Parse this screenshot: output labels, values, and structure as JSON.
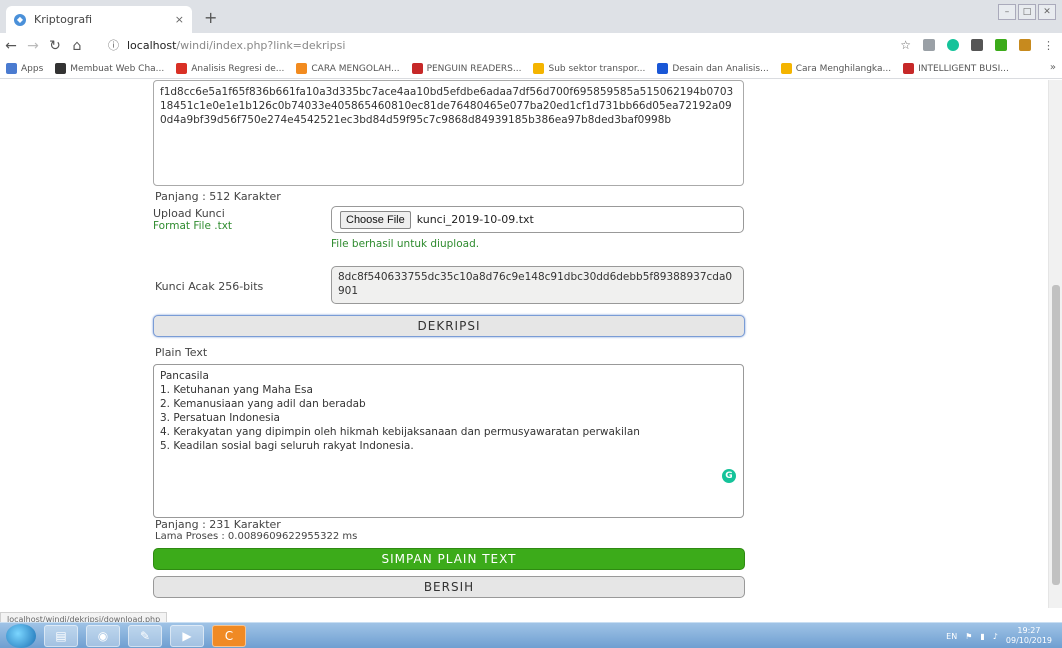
{
  "browser": {
    "tab_title": "Kriptografi",
    "tab_close": "×",
    "new_tab": "+",
    "url_host": "localhost",
    "url_path": "/windi/index.php?link=dekripsi",
    "bookmarks": [
      {
        "label": "Apps",
        "color": "#4a7bd0"
      },
      {
        "label": "Membuat Web Cha...",
        "color": "#333333"
      },
      {
        "label": "Analisis Regresi de...",
        "color": "#d93025"
      },
      {
        "label": "CARA MENGOLAH...",
        "color": "#f28b1f"
      },
      {
        "label": "PENGUIN READERS...",
        "color": "#c62828"
      },
      {
        "label": "Sub sektor transpor...",
        "color": "#f4b400"
      },
      {
        "label": "Desain dan Analisis...",
        "color": "#1a57d6"
      },
      {
        "label": "Cara Menghilangka...",
        "color": "#f4b400"
      },
      {
        "label": "INTELLIGENT BUSI...",
        "color": "#c62828"
      }
    ],
    "bookmarks_more": "»"
  },
  "page": {
    "cipher_text": "f1d8cc6e5a1f65f836b661fa10a3d335bc7ace4aa10bd5efdbe6adaa7df56d700f695859585a515062194b070318451c1e0e1e1b126c0b74033e405865460810ec81de76480465e077ba20ed1cf1d731bb66d05ea72192a090d4a9bf39d56f750e274e4542521ec3bd84d59f95c7c9868d84939185b386ea97b8ded3baf0998b",
    "cipher_length": "Panjang : 512 Karakter",
    "upload_label": "Upload Kunci",
    "upload_format": "Format File .txt",
    "choose_file": "Choose File",
    "file_name": "kunci_2019-10-09.txt",
    "upload_success": "File berhasil untuk diupload.",
    "key_label": "Kunci Acak 256-bits",
    "key_value": "8dc8f540633755dc35c10a8d76c9e148c91dbc30dd6debb5f89388937cda0901",
    "decrypt_button": "DEKRIPSI",
    "plain_label": "Plain Text",
    "plain_lines": [
      "Pancasila",
      "1. Ketuhanan yang Maha Esa",
      "2. Kemanusiaan yang adil dan beradab",
      "3. Persatuan Indonesia",
      "4. Kerakyatan yang dipimpin oleh hikmah kebijaksanaan dan permusyawaratan perwakilan",
      "5. Keadilan sosial bagi seluruh rakyat Indonesia."
    ],
    "plain_length": "Panjang : 231 Karakter",
    "process_time": "Lama Proses : 0.0089609622955322 ms",
    "save_button": "SIMPAN PLAIN TEXT",
    "clear_button": "BERSIH"
  },
  "status_url": "localhost/windi/dekripsi/download.php",
  "taskbar": {
    "lang": "EN",
    "time": "19:27",
    "date": "09/10/2019"
  }
}
